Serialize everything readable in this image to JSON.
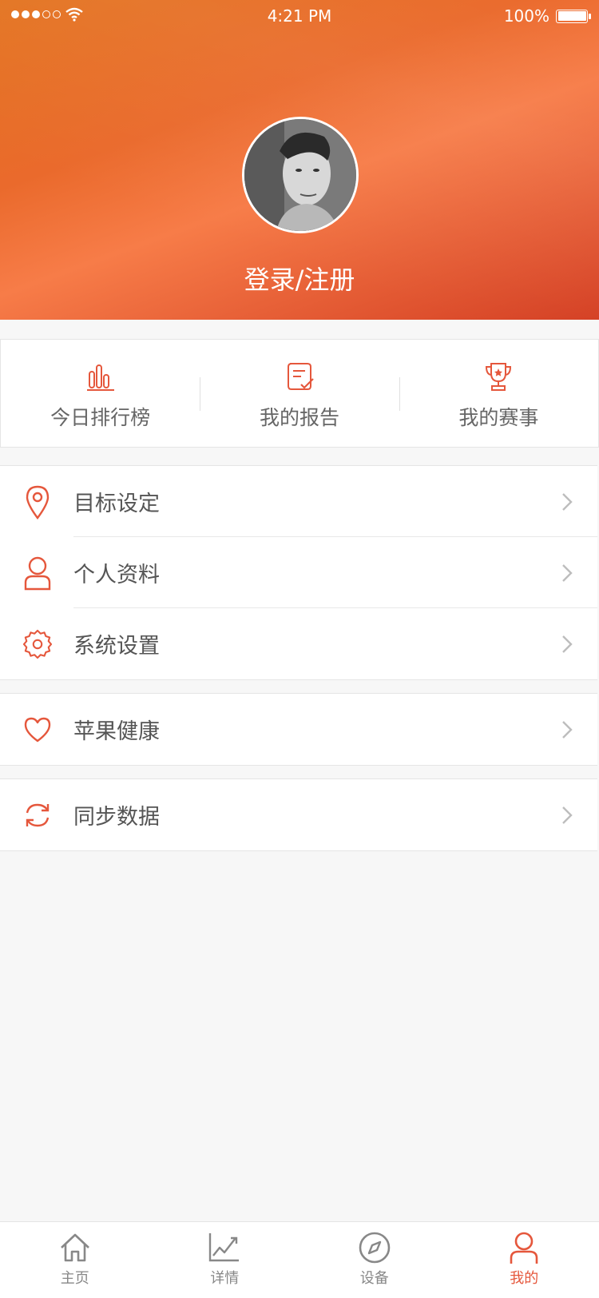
{
  "status_bar": {
    "time": "4:21 PM",
    "battery": "100%",
    "signal_icon": "signal-dots-icon",
    "wifi_icon": "wifi-icon",
    "battery_icon": "battery-icon"
  },
  "profile": {
    "login_text": "登录/注册",
    "avatar_icon": "avatar-photo"
  },
  "quick_actions": [
    {
      "label": "今日排行榜",
      "icon": "bar-chart-icon"
    },
    {
      "label": "我的报告",
      "icon": "report-icon"
    },
    {
      "label": "我的赛事",
      "icon": "trophy-icon"
    }
  ],
  "menu": {
    "group1": [
      {
        "label": "目标设定",
        "icon": "location-pin-icon"
      },
      {
        "label": "个人资料",
        "icon": "person-icon"
      },
      {
        "label": "系统设置",
        "icon": "gear-icon"
      }
    ],
    "group2": [
      {
        "label": "苹果健康",
        "icon": "heart-icon"
      }
    ],
    "group3": [
      {
        "label": "同步数据",
        "icon": "sync-icon"
      }
    ]
  },
  "tabbar": [
    {
      "label": "主页",
      "icon": "home-icon",
      "active": false
    },
    {
      "label": "详情",
      "icon": "line-chart-icon",
      "active": false
    },
    {
      "label": "设备",
      "icon": "compass-icon",
      "active": false
    },
    {
      "label": "我的",
      "icon": "person-icon",
      "active": true
    }
  ],
  "colors": {
    "accent": "#e5573c",
    "header_start": "#e3731f",
    "header_end": "#d43f23"
  }
}
